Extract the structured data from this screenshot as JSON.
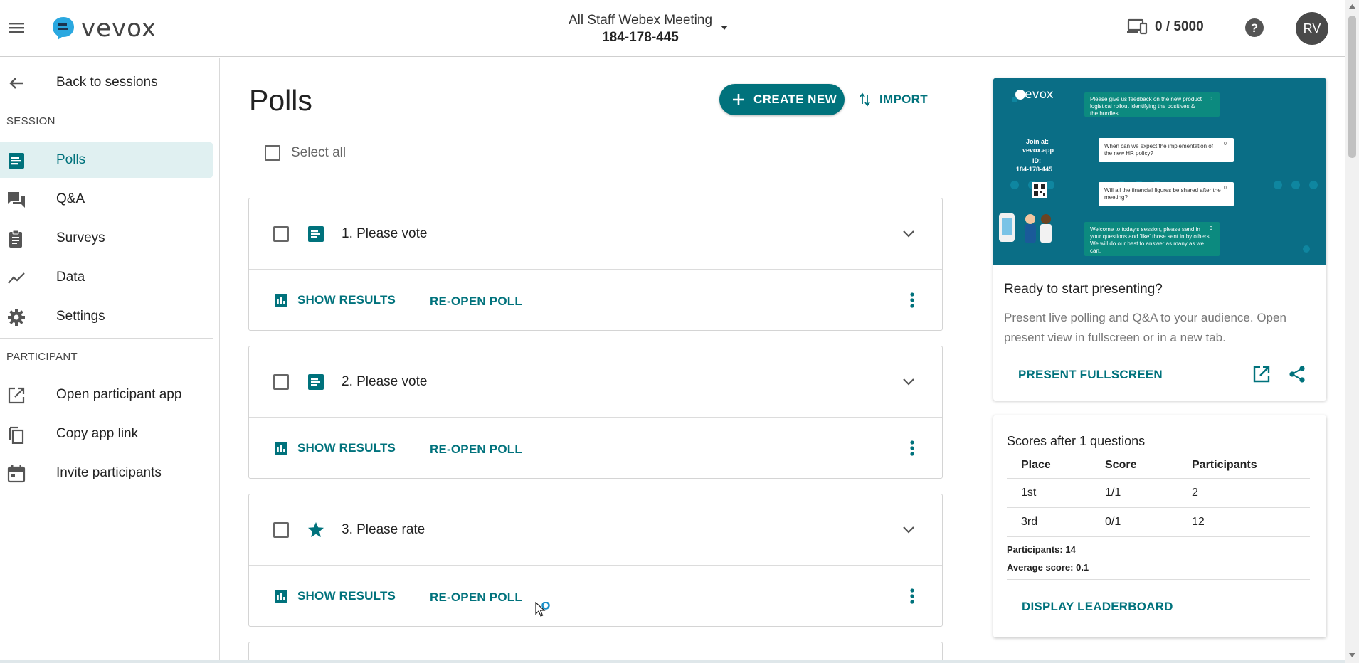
{
  "header": {
    "logo_text": "vevox",
    "session_name": "All Staff Webex Meeting",
    "session_id": "184-178-445",
    "participants_count": "0 / 5000",
    "avatar_initials": "RV"
  },
  "sidebar": {
    "back_label": "Back to sessions",
    "session_section": "SESSION",
    "session_items": [
      {
        "label": "Polls",
        "icon": "polls-icon",
        "active": true
      },
      {
        "label": "Q&A",
        "icon": "qa-icon"
      },
      {
        "label": "Surveys",
        "icon": "clipboard-icon"
      },
      {
        "label": "Data",
        "icon": "trend-icon"
      },
      {
        "label": "Settings",
        "icon": "gear-icon"
      }
    ],
    "participant_section": "PARTICIPANT",
    "participant_items": [
      {
        "label": "Open participant app",
        "icon": "open-external-icon"
      },
      {
        "label": "Copy app link",
        "icon": "copy-icon"
      },
      {
        "label": "Invite participants",
        "icon": "calendar-icon"
      }
    ]
  },
  "main": {
    "title": "Polls",
    "create_label": "CREATE NEW",
    "import_label": "IMPORT",
    "select_all_label": "Select all",
    "polls": [
      {
        "title": "1. Please vote",
        "type_icon": "poll-list-icon"
      },
      {
        "title": "2. Please vote",
        "type_icon": "poll-list-icon"
      },
      {
        "title": "3. Please rate",
        "type_icon": "star-icon"
      }
    ],
    "show_results_label": "SHOW RESULTS",
    "reopen_label": "RE-OPEN POLL"
  },
  "present": {
    "preview": {
      "logo_text": "vevox",
      "join_label": "Join at:",
      "join_url": "vevox.app",
      "id_label": "ID:",
      "id_value": "184-178-445",
      "bubbles": [
        "Please give us feedback on the new product logistical rollout identifying the positives & the hurdles.",
        "When can we expect the implementation of the new HR policy?",
        "Will all the financial figures be shared after the meeting?",
        "Welcome to today's session, please send in your questions and 'like' those sent in by others.  We will do our best to answer as many as we can."
      ],
      "like_count": "0"
    },
    "title": "Ready to start presenting?",
    "description": "Present live polling and Q&A to your audience. Open present view in fullscreen or in a new tab.",
    "fullscreen_label": "PRESENT FULLSCREEN"
  },
  "scores": {
    "title": "Scores after 1 questions",
    "columns": [
      "Place",
      "Score",
      "Participants"
    ],
    "rows": [
      [
        "1st",
        "1/1",
        "2"
      ],
      [
        "3rd",
        "0/1",
        "12"
      ]
    ],
    "participants_label": "Participants:",
    "participants_value": "14",
    "average_label": "Average score:",
    "average_value": "0.1",
    "leaderboard_label": "DISPLAY LEADERBOARD"
  },
  "colors": {
    "accent": "#00727c",
    "active_bg": "#e0f0f1",
    "preview_bg": "#0a6e86"
  }
}
